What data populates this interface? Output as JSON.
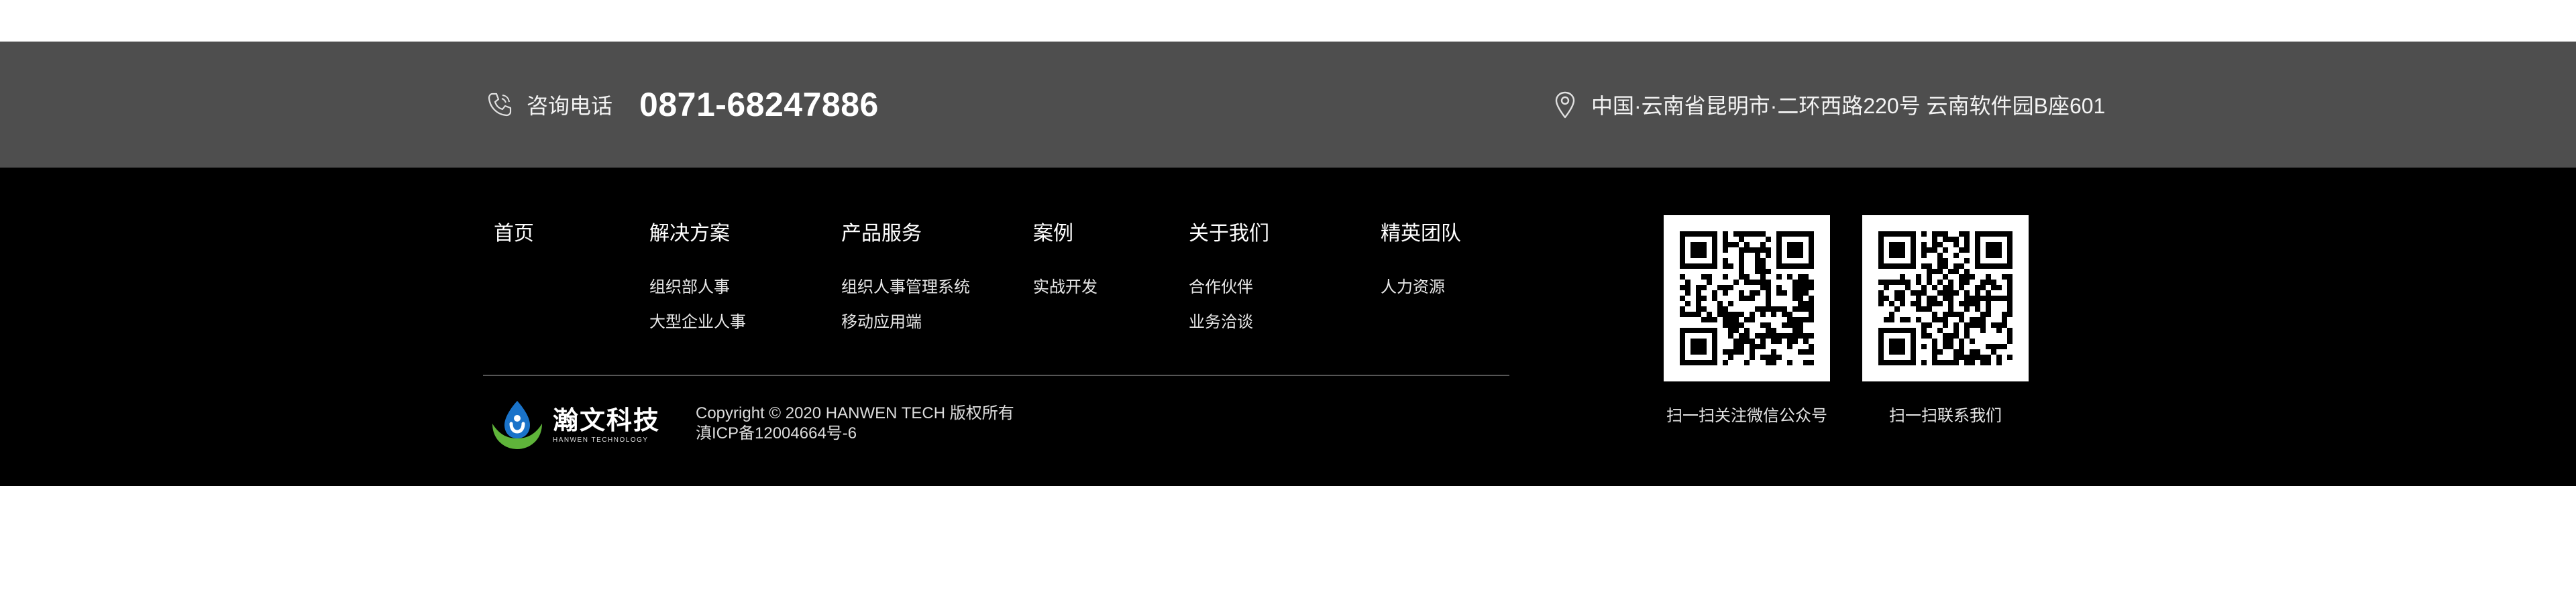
{
  "contact": {
    "phone_label": "咨询电话",
    "phone_number": "0871-68247886",
    "address": "中国·云南省昆明市·二环西路220号 云南软件园B座601",
    "phone_icon": "phone-icon",
    "location_icon": "map-pin-icon"
  },
  "nav": {
    "columns": [
      {
        "title": "首页",
        "items": []
      },
      {
        "title": "解决方案",
        "items": [
          "组织部人事",
          "大型企业人事"
        ]
      },
      {
        "title": "产品服务",
        "items": [
          "组织人事管理系统",
          "移动应用端"
        ]
      },
      {
        "title": "案例",
        "items": [
          "实战开发"
        ]
      },
      {
        "title": "关于我们",
        "items": [
          "合作伙伴",
          "业务洽谈"
        ]
      },
      {
        "title": "精英团队",
        "items": [
          "人力资源"
        ]
      }
    ]
  },
  "brand": {
    "name_cn": "瀚文科技",
    "name_en": "HANWEN TECHNOLOGY"
  },
  "copyright": {
    "line1": "Copyright © 2020 HANWEN TECH 版权所有",
    "line2": "滇ICP备12004664号-6"
  },
  "qr_codes": {
    "wechat_caption": "扫一扫关注微信公众号",
    "contact_caption": "扫一扫联系我们"
  },
  "colors": {
    "contact_bar": "#4e4e4e",
    "footer": "#000000",
    "logo_green": "#5fb43a",
    "logo_blue": "#1a73c9"
  }
}
